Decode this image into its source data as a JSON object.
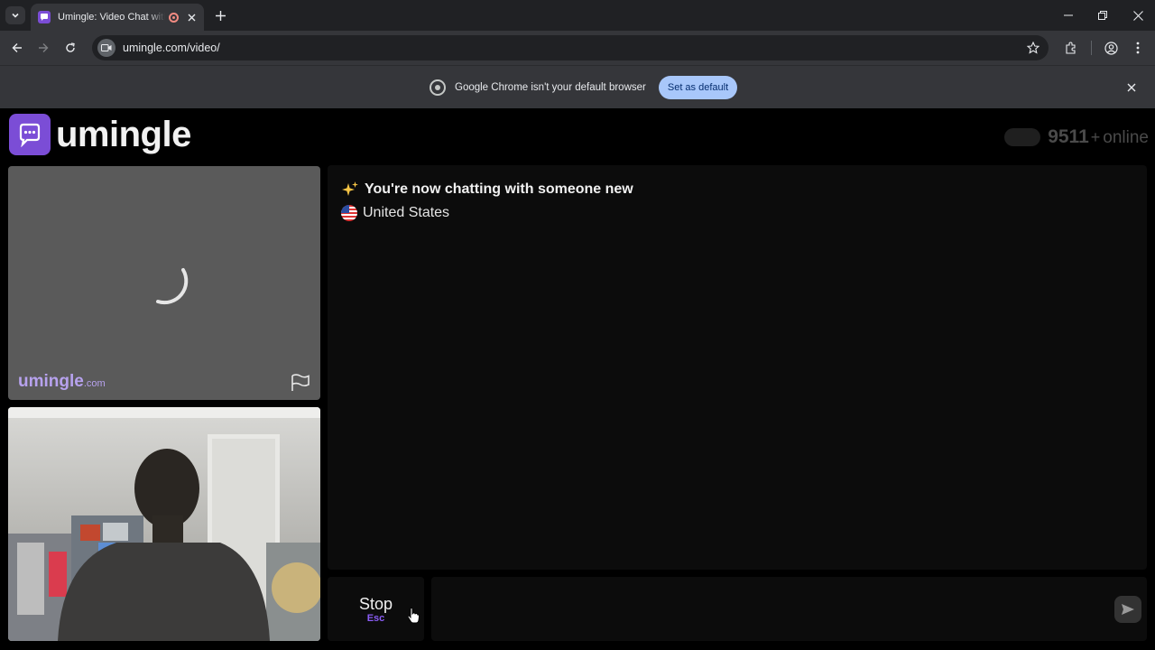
{
  "browser": {
    "tab": {
      "title": "Umingle: Video Chat with Strangers"
    },
    "address": {
      "url": "umingle.com/video/"
    },
    "infobar": {
      "message": "Google Chrome isn't your default browser",
      "button_label": "Set as default"
    }
  },
  "header": {
    "logo_text": "umingle",
    "online_count": "9511",
    "online_plus": "+",
    "online_label": "online"
  },
  "remote_video": {
    "watermark_main": "umingle",
    "watermark_suffix": ".com"
  },
  "chat": {
    "system_message": "You're now chatting with someone new",
    "country": "United States"
  },
  "controls": {
    "stop_label": "Stop",
    "stop_key": "Esc",
    "input_placeholder": ""
  },
  "colors": {
    "brand": "#7b4dd6",
    "accent": "#8a5cf5",
    "chrome_button": "#a8c7fa"
  },
  "icons": [
    "tab-search-icon",
    "chat-bubble-icon",
    "record-icon",
    "close-icon",
    "plus-icon",
    "minimize-icon",
    "restore-icon",
    "back-arrow-icon",
    "forward-arrow-icon",
    "reload-icon",
    "site-info-icon",
    "star-icon",
    "extensions-icon",
    "profile-icon",
    "menu-icon",
    "chrome-icon",
    "spinner-icon",
    "flag-icon",
    "sparkle-icon",
    "us-flag-icon",
    "send-icon",
    "cursor-icon"
  ]
}
